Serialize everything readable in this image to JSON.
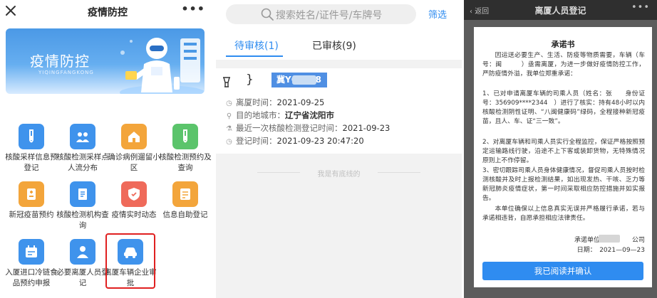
{
  "panel1": {
    "title": "疫情防控",
    "more": "•••",
    "banner": {
      "title": "疫情防控",
      "subtitle": "YIQINGFANGKONG"
    },
    "grid": [
      {
        "label": "核酸采样信息预登记",
        "icon": "test-tube-icon",
        "color": "#3f93ec"
      },
      {
        "label": "核酸检测采样点人流分布",
        "icon": "people-icon",
        "color": "#3f93ec"
      },
      {
        "label": "确诊病例遛留小区",
        "icon": "house-icon",
        "color": "#f3a53b"
      },
      {
        "label": "核酸检测预约及查询",
        "icon": "test-tube-icon",
        "color": "#5bc46b"
      },
      {
        "label": "新冠疫苗预约",
        "icon": "vaccine-icon",
        "color": "#f3a53b"
      },
      {
        "label": "核酸检测机构查询",
        "icon": "document-icon",
        "color": "#3f93ec"
      },
      {
        "label": "疫情实时动态",
        "icon": "shield-icon",
        "color": "#ef6a5a"
      },
      {
        "label": "信息自助登记",
        "icon": "form-icon",
        "color": "#f3a53b"
      },
      {
        "label": "入厦进口冷链食品预约申报",
        "icon": "calendar-icon",
        "color": "#3f93ec"
      },
      {
        "label": "必要离厦人员登记",
        "icon": "person-icon",
        "color": "#3f93ec"
      },
      {
        "label": "离厦车辆企业审批",
        "icon": "car-icon",
        "color": "#3f93ec"
      }
    ]
  },
  "panel2": {
    "search_placeholder": "搜索姓名/证件号/车牌号",
    "filter": "筛选",
    "tabs": [
      {
        "label": "待审核(1)"
      },
      {
        "label": "已审核(9)"
      }
    ],
    "card": {
      "brace": "}",
      "plate": "冀YG",
      "plate_tail": "8",
      "rows": [
        {
          "label": "离厦时间：",
          "value": "2021-09-25"
        },
        {
          "label": "目的地城市：",
          "value": "辽宁省沈阳市",
          "highlight": true
        },
        {
          "label": "最近一次核酸检测登记时间：",
          "value": "2021-09-23"
        },
        {
          "label": "登记时间：",
          "value": "2021-09-23 20:47:20"
        }
      ]
    },
    "end_note": "我是有底线的",
    "colors": {
      "accent": "#2f8cf0"
    }
  },
  "panel3": {
    "back": "返回",
    "title": "离厦人员登记",
    "more": "•••",
    "letter": {
      "title": "承诺书",
      "paragraphs": [
        "因运送必要生产、生活、防疫等物质需要，车辆（车号：闽　　　）亟需离厦，为进一步做好疫情防控工作，严防疫情外溢，我单位郑重承诺：",
        "1、已对申请离厦车辆的司乘人员（姓名：张　　身份证号：356909****2344　）进行了核实：持有48小时以内核酸检测阴性证明、“八闽健康码”绿码，全程接种新冠疫苗，且人、车、证“三一致”。",
        "2、对离厦车辆和司乘人员实行全程监控，保证严格按照预定运输路线行驶，沿途不上下客或装卸货物，无特殊情况原则上不作停留。",
        "3、密切跟踪司乘人员身体健康情况，督促司乘人员按时检测核酸并及时上报检测结果，如出现发热、干咳、乏力等新冠肺炎疫情症状，第一时间采取相应防控措施并如实报告。",
        "本单位确保以上信息真实无误并严格履行承诺，若与承诺相违背，自愿承担相应法律责任。"
      ],
      "sign_unit": "承诺单位：飞　　　公司",
      "sign_date": "日期：　2021—09—23"
    },
    "confirm": "我已阅读并确认"
  }
}
